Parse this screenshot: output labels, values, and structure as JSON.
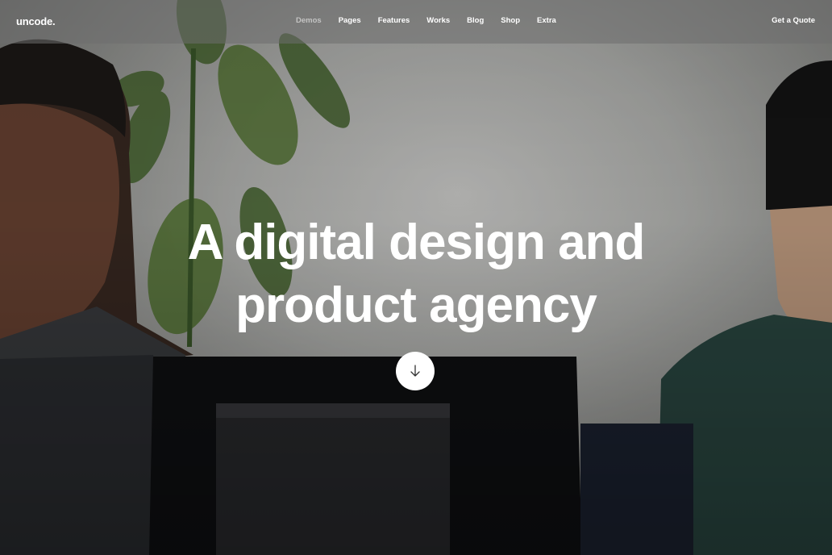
{
  "brand": {
    "logo_text": "uncode."
  },
  "nav": {
    "items": [
      {
        "label": "Demos",
        "active": true
      },
      {
        "label": "Pages"
      },
      {
        "label": "Features"
      },
      {
        "label": "Works"
      },
      {
        "label": "Blog"
      },
      {
        "label": "Shop"
      },
      {
        "label": "Extra"
      }
    ],
    "cta_label": "Get a Quote"
  },
  "hero": {
    "headline_line1": "A digital design and",
    "headline_line2": "product agency",
    "scroll_icon": "arrow-down-icon"
  },
  "colors": {
    "text": "#ffffff",
    "button_bg": "#ffffff",
    "icon": "#333333"
  }
}
